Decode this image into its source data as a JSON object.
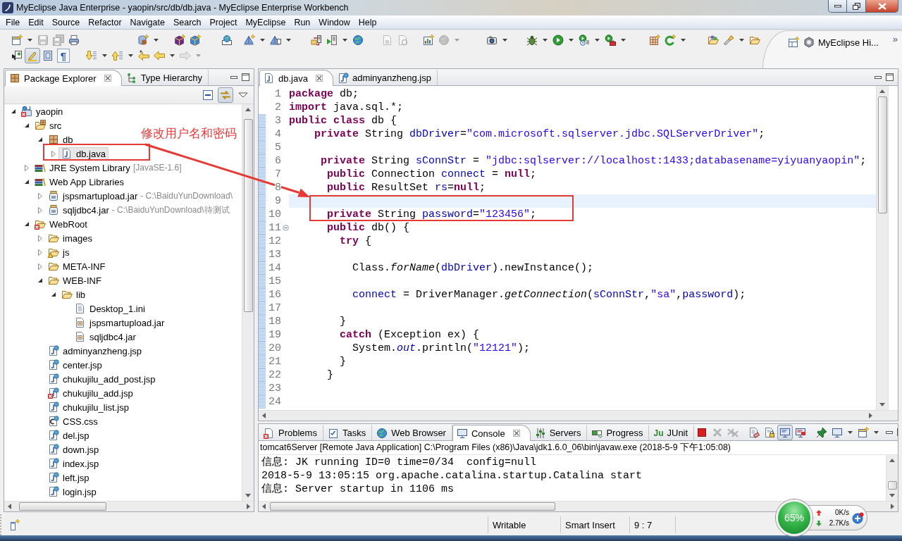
{
  "window": {
    "title": "MyEclipse Java Enterprise - yaopin/src/db/db.java - MyEclipse Enterprise Workbench"
  },
  "menu": [
    "File",
    "Edit",
    "Source",
    "Refactor",
    "Navigate",
    "Search",
    "Project",
    "MyEclipse",
    "Run",
    "Window",
    "Help"
  ],
  "toolbar": {
    "rows": [
      [
        [
          {
            "kind": "new-wizard",
            "disabled": false,
            "pressed": false,
            "dropdown": true
          },
          {
            "kind": "save",
            "disabled": true,
            "pressed": false
          },
          {
            "kind": "save-all",
            "disabled": true,
            "pressed": false
          },
          {
            "kind": "print",
            "disabled": false,
            "pressed": false
          }
        ],
        [
          {
            "kind": "new-db",
            "disabled": false,
            "pressed": false,
            "dropdown": true
          }
        ],
        [
          {
            "kind": "cube-purple",
            "disabled": false,
            "pressed": false
          },
          {
            "kind": "cube-blue",
            "disabled": false,
            "pressed": false
          }
        ],
        [
          {
            "kind": "web-badge",
            "disabled": false,
            "pressed": false
          }
        ],
        [
          {
            "kind": "pyramid-star",
            "disabled": false,
            "pressed": false,
            "dropdown": true
          },
          {
            "kind": "pyramid-doc",
            "disabled": false,
            "pressed": false,
            "dropdown": true
          }
        ],
        [
          {
            "kind": "server-arrow",
            "disabled": false,
            "pressed": false
          },
          {
            "kind": "server-play",
            "disabled": false,
            "pressed": false,
            "dropdown": true
          },
          {
            "kind": "globe",
            "disabled": false,
            "pressed": false
          }
        ],
        [
          {
            "kind": "doc-hand",
            "disabled": true,
            "pressed": false
          },
          {
            "kind": "doc-refresh",
            "disabled": true,
            "pressed": false
          }
        ],
        [
          {
            "kind": "chart-star",
            "disabled": false,
            "pressed": false
          },
          {
            "kind": "globe",
            "disabled": true,
            "pressed": false,
            "dropdown": true
          }
        ],
        [
          {
            "kind": "camera",
            "disabled": false,
            "pressed": false,
            "dropdown": true
          }
        ],
        [
          {
            "kind": "bug",
            "disabled": false,
            "pressed": false,
            "dropdown": true
          },
          {
            "kind": "run",
            "disabled": false,
            "pressed": false,
            "dropdown": true
          },
          {
            "kind": "run-history",
            "disabled": false,
            "pressed": false,
            "dropdown": true
          },
          {
            "kind": "run-tools",
            "disabled": false,
            "pressed": false,
            "dropdown": true
          }
        ],
        [
          {
            "kind": "grid-star",
            "disabled": false,
            "pressed": false
          },
          {
            "kind": "refresh-c",
            "disabled": false,
            "pressed": false,
            "dropdown": true
          }
        ],
        [
          {
            "kind": "folder-balls",
            "disabled": false,
            "pressed": false
          },
          {
            "kind": "flashlight",
            "disabled": false,
            "pressed": false,
            "dropdown": true
          },
          {
            "kind": "folder-open",
            "disabled": false,
            "pressed": false
          }
        ]
      ],
      [
        [
          {
            "kind": "doc-cursor",
            "disabled": false,
            "pressed": false
          },
          {
            "kind": "highlighter",
            "disabled": false,
            "pressed": true
          },
          {
            "kind": "frame",
            "disabled": false,
            "pressed": false
          },
          {
            "kind": "glyph",
            "glyph": "¶",
            "disabled": false,
            "pressed": false
          }
        ],
        [
          {
            "kind": "arrow-down",
            "disabled": false,
            "pressed": false,
            "dropdown": true
          },
          {
            "kind": "arrow-up",
            "disabled": false,
            "pressed": false,
            "dropdown": true
          },
          {
            "kind": "arrow-star-left",
            "disabled": false,
            "pressed": false
          },
          {
            "kind": "arrow-left",
            "disabled": false,
            "pressed": false,
            "dropdown": true
          },
          {
            "kind": "arrow-right",
            "disabled": true,
            "pressed": false,
            "dropdown": true
          }
        ]
      ]
    ]
  },
  "perspectives": {
    "items": [
      {
        "kind": "open-perspective"
      },
      {
        "kind": "myeclipse",
        "label": "MyEclipse Hi..."
      }
    ],
    "more": "»"
  },
  "package_explorer": {
    "tabs": [
      {
        "label": "Package Explorer",
        "kind": "package-explorer",
        "selected": true
      },
      {
        "label": "Type Hierarchy",
        "kind": "hierarchy",
        "selected": false
      }
    ],
    "view_toolbar": [
      {
        "kind": "collapse-all",
        "disabled": false,
        "pressed": false
      },
      {
        "kind": "link-editor",
        "disabled": false,
        "pressed": true
      },
      {
        "kind": "view-menu",
        "disabled": false,
        "pressed": false
      }
    ],
    "tree": [
      {
        "label": "yaopin",
        "kind": "project",
        "error": true,
        "expanded": true,
        "selected": false,
        "children": [
          {
            "label": "src",
            "kind": "source-folder",
            "expanded": true,
            "selected": false,
            "children": [
              {
                "label": "db",
                "kind": "package",
                "expanded": true,
                "selected": false,
                "children": [
                  {
                    "label": "db.java",
                    "kind": "java-file",
                    "expanded": false,
                    "selected": true
                  }
                ]
              }
            ]
          },
          {
            "label": "JRE System Library",
            "detail": "[JavaSE-1.6]",
            "kind": "library",
            "expanded": false,
            "selected": false
          },
          {
            "label": "Web App Libraries",
            "kind": "library",
            "expanded": true,
            "selected": false,
            "children": [
              {
                "label": "jspsmartupload.jar",
                "detail": "- C:\\BaiduYunDownload\\",
                "kind": "jar",
                "expanded": false,
                "selected": false
              },
              {
                "label": "sqljdbc4.jar",
                "detail": "- C:\\BaiduYunDownload\\待测试",
                "kind": "jar",
                "expanded": false,
                "selected": false
              }
            ]
          },
          {
            "label": "WebRoot",
            "kind": "web-folder",
            "error": true,
            "expanded": true,
            "selected": false,
            "children": [
              {
                "label": "images",
                "kind": "folder",
                "expanded": false,
                "selected": false
              },
              {
                "label": "js",
                "kind": "folder",
                "warning": true,
                "expanded": false,
                "selected": false
              },
              {
                "label": "META-INF",
                "kind": "folder",
                "expanded": false,
                "selected": false
              },
              {
                "label": "WEB-INF",
                "kind": "folder",
                "expanded": true,
                "selected": false,
                "children": [
                  {
                    "label": "lib",
                    "kind": "folder",
                    "expanded": true,
                    "selected": false,
                    "children": [
                      {
                        "label": "Desktop_1.ini",
                        "kind": "text-file",
                        "selected": false
                      },
                      {
                        "label": "jspsmartupload.jar",
                        "kind": "archive-file",
                        "selected": false
                      },
                      {
                        "label": "sqljdbc4.jar",
                        "kind": "archive-file",
                        "selected": false
                      }
                    ]
                  }
                ]
              },
              {
                "label": "adminyanzheng.jsp",
                "kind": "jsp",
                "selected": false
              },
              {
                "label": "center.jsp",
                "kind": "jsp",
                "selected": false
              },
              {
                "label": "chukujilu_add_post.jsp",
                "kind": "jsp",
                "selected": false
              },
              {
                "label": "chukujilu_add.jsp",
                "kind": "jsp",
                "error": true,
                "selected": false
              },
              {
                "label": "chukujilu_list.jsp",
                "kind": "jsp",
                "selected": false
              },
              {
                "label": "CSS.css",
                "kind": "css",
                "selected": false
              },
              {
                "label": "del.jsp",
                "kind": "jsp",
                "selected": false
              },
              {
                "label": "down.jsp",
                "kind": "jsp",
                "selected": false
              },
              {
                "label": "index.jsp",
                "kind": "jsp",
                "selected": false
              },
              {
                "label": "left.jsp",
                "kind": "jsp",
                "selected": false
              },
              {
                "label": "login.jsp",
                "kind": "jsp",
                "selected": false
              }
            ]
          }
        ]
      }
    ]
  },
  "editor": {
    "tabs": [
      {
        "label": "db.java",
        "kind": "java-file",
        "selected": true
      },
      {
        "label": "adminyanzheng.jsp",
        "kind": "jsp",
        "selected": false
      }
    ],
    "lines": [
      {
        "number": "1",
        "in_range": false,
        "current": false,
        "folding": false,
        "tokens": [
          {
            "kind": "keyword",
            "text": "package"
          },
          {
            "kind": "plain",
            "text": " db;"
          }
        ]
      },
      {
        "number": "2",
        "in_range": false,
        "current": false,
        "folding": false,
        "tokens": [
          {
            "kind": "keyword",
            "text": "import"
          },
          {
            "kind": "plain",
            "text": " java.sql.*;"
          }
        ]
      },
      {
        "number": "3",
        "in_range": true,
        "current": false,
        "folding": false,
        "tokens": [
          {
            "kind": "keyword",
            "text": "public "
          },
          {
            "kind": "keyword",
            "text": "class"
          },
          {
            "kind": "plain",
            "text": " db {"
          }
        ]
      },
      {
        "number": "4",
        "in_range": true,
        "current": false,
        "folding": false,
        "tokens": [
          {
            "kind": "keyword",
            "text": "    private"
          },
          {
            "kind": "plain",
            "text": " String "
          },
          {
            "kind": "field",
            "text": "dbDriver"
          },
          {
            "kind": "plain",
            "text": "="
          },
          {
            "kind": "string",
            "text": "\"com.microsoft.sqlserver.jdbc.SQLServerDriver\""
          },
          {
            "kind": "plain",
            "text": ";"
          }
        ]
      },
      {
        "number": "5",
        "in_range": true,
        "current": false,
        "folding": false
      },
      {
        "number": "6",
        "in_range": true,
        "current": false,
        "folding": false,
        "tokens": [
          {
            "kind": "keyword",
            "text": "     private"
          },
          {
            "kind": "plain",
            "text": " String "
          },
          {
            "kind": "field",
            "text": "sConnStr"
          },
          {
            "kind": "plain",
            "text": " = "
          },
          {
            "kind": "string",
            "text": "\"jdbc:sqlserver://localhost:1433;databasename=yiyuanyaopin\""
          },
          {
            "kind": "plain",
            "text": ";"
          }
        ]
      },
      {
        "number": "7",
        "in_range": true,
        "current": false,
        "folding": false,
        "tokens": [
          {
            "kind": "keyword",
            "text": "      public"
          },
          {
            "kind": "plain",
            "text": " Connection "
          },
          {
            "kind": "field",
            "text": "connect"
          },
          {
            "kind": "plain",
            "text": " = "
          },
          {
            "kind": "keyword",
            "text": "null"
          },
          {
            "kind": "plain",
            "text": ";"
          }
        ]
      },
      {
        "number": "8",
        "in_range": true,
        "current": false,
        "folding": false,
        "tokens": [
          {
            "kind": "keyword",
            "text": "      public"
          },
          {
            "kind": "plain",
            "text": " ResultSet "
          },
          {
            "kind": "field",
            "text": "rs"
          },
          {
            "kind": "plain",
            "text": "="
          },
          {
            "kind": "keyword",
            "text": "null"
          },
          {
            "kind": "plain",
            "text": ";"
          }
        ]
      },
      {
        "number": "9",
        "in_range": true,
        "current": true,
        "folding": false
      },
      {
        "number": "10",
        "in_range": true,
        "current": false,
        "folding": false,
        "tokens": [
          {
            "kind": "keyword",
            "text": "      private"
          },
          {
            "kind": "plain",
            "text": " String "
          },
          {
            "kind": "field",
            "text": "password"
          },
          {
            "kind": "plain",
            "text": "="
          },
          {
            "kind": "string",
            "text": "\"123456\""
          },
          {
            "kind": "plain",
            "text": ";"
          }
        ]
      },
      {
        "number": "11",
        "in_range": true,
        "current": false,
        "folding": true,
        "tokens": [
          {
            "kind": "keyword",
            "text": "      public"
          },
          {
            "kind": "plain",
            "text": " db() {"
          }
        ]
      },
      {
        "number": "12",
        "in_range": true,
        "current": false,
        "folding": false,
        "tokens": [
          {
            "kind": "keyword",
            "text": "        try"
          },
          {
            "kind": "plain",
            "text": " {"
          }
        ]
      },
      {
        "number": "13",
        "in_range": true,
        "current": false,
        "folding": false
      },
      {
        "number": "14",
        "in_range": true,
        "current": false,
        "folding": false,
        "tokens": [
          {
            "kind": "plain",
            "text": "          Class."
          },
          {
            "kind": "static-method",
            "text": "forName"
          },
          {
            "kind": "plain",
            "text": "("
          },
          {
            "kind": "field",
            "text": "dbDriver"
          },
          {
            "kind": "plain",
            "text": ").newInstance();"
          }
        ]
      },
      {
        "number": "15",
        "in_range": true,
        "current": false,
        "folding": false
      },
      {
        "number": "16",
        "in_range": true,
        "current": false,
        "folding": false,
        "tokens": [
          {
            "kind": "field",
            "text": "          connect"
          },
          {
            "kind": "plain",
            "text": " = DriverManager."
          },
          {
            "kind": "static-method",
            "text": "getConnection"
          },
          {
            "kind": "plain",
            "text": "("
          },
          {
            "kind": "field",
            "text": "sConnStr"
          },
          {
            "kind": "plain",
            "text": ","
          },
          {
            "kind": "string",
            "text": "\"sa\""
          },
          {
            "kind": "plain",
            "text": ","
          },
          {
            "kind": "field",
            "text": "password"
          },
          {
            "kind": "plain",
            "text": ");"
          }
        ]
      },
      {
        "number": "17",
        "in_range": true,
        "current": false,
        "folding": false
      },
      {
        "number": "18",
        "in_range": true,
        "current": false,
        "folding": false,
        "tokens": [
          {
            "kind": "plain",
            "text": "        }"
          }
        ]
      },
      {
        "number": "19",
        "in_range": true,
        "current": false,
        "folding": false,
        "tokens": [
          {
            "kind": "keyword",
            "text": "        catch"
          },
          {
            "kind": "plain",
            "text": " (Exception ex) {"
          }
        ]
      },
      {
        "number": "20",
        "in_range": true,
        "current": false,
        "folding": false,
        "tokens": [
          {
            "kind": "plain",
            "text": "          System."
          },
          {
            "kind": "static-field",
            "text": "out"
          },
          {
            "kind": "plain",
            "text": ".println("
          },
          {
            "kind": "string",
            "text": "\"12121\""
          },
          {
            "kind": "plain",
            "text": ");"
          }
        ]
      },
      {
        "number": "21",
        "in_range": true,
        "current": false,
        "folding": false,
        "tokens": [
          {
            "kind": "plain",
            "text": "        }"
          }
        ]
      },
      {
        "number": "22",
        "in_range": true,
        "current": false,
        "folding": false,
        "tokens": [
          {
            "kind": "plain",
            "text": "      }"
          }
        ]
      },
      {
        "number": "23",
        "in_range": true,
        "current": false,
        "folding": false
      },
      {
        "number": "24",
        "in_range": true,
        "current": false,
        "folding": false
      }
    ]
  },
  "console": {
    "tabs": [
      {
        "label": "Problems",
        "kind": "problems",
        "selected": false
      },
      {
        "label": "Tasks",
        "kind": "tasks",
        "selected": false
      },
      {
        "label": "Web Browser",
        "kind": "web-browser",
        "selected": false
      },
      {
        "label": "Console",
        "kind": "console",
        "selected": true
      },
      {
        "label": "Servers",
        "kind": "servers",
        "selected": false
      },
      {
        "label": "Progress",
        "kind": "progress",
        "selected": false
      },
      {
        "label": "JUnit",
        "kind": "glyph",
        "glyph": "Ju",
        "selected": false
      }
    ],
    "toolbar": [
      [
        {
          "kind": "terminate",
          "disabled": false,
          "pressed": false
        },
        {
          "kind": "remove",
          "disabled": true,
          "pressed": false
        },
        {
          "kind": "remove-all",
          "disabled": true,
          "pressed": false
        }
      ],
      [
        {
          "kind": "clear",
          "disabled": false,
          "pressed": false
        },
        {
          "kind": "scroll-lock",
          "disabled": false,
          "pressed": false
        },
        {
          "kind": "stdout",
          "disabled": false,
          "pressed": true
        },
        {
          "kind": "stderr",
          "disabled": false,
          "pressed": false
        }
      ],
      [
        {
          "kind": "pin",
          "disabled": false,
          "pressed": false
        },
        {
          "kind": "display-console",
          "disabled": false,
          "pressed": false,
          "dropdown": true
        },
        {
          "kind": "open-console",
          "disabled": false,
          "pressed": false,
          "dropdown": true
        }
      ]
    ],
    "process": "tomcat6Server [Remote Java Application] C:\\Program Files (x86)\\Java\\jdk1.6.0_06\\bin\\javaw.exe (2018-5-9 下午1:05:08)",
    "lines": [
      "信息: JK running ID=0 time=0/34  config=null",
      "2018-5-9 13:05:15 org.apache.catalina.startup.Catalina start",
      "信息: Server startup in 1106 ms"
    ]
  },
  "status_bar": {
    "fields": [
      "Writable",
      "Smart Insert",
      "9 : 7"
    ]
  },
  "network_monitor": {
    "usage": "65%",
    "upload": "0K/s",
    "download": "2.7K/s"
  },
  "annotation": {
    "note": "修改用户名和密码"
  }
}
